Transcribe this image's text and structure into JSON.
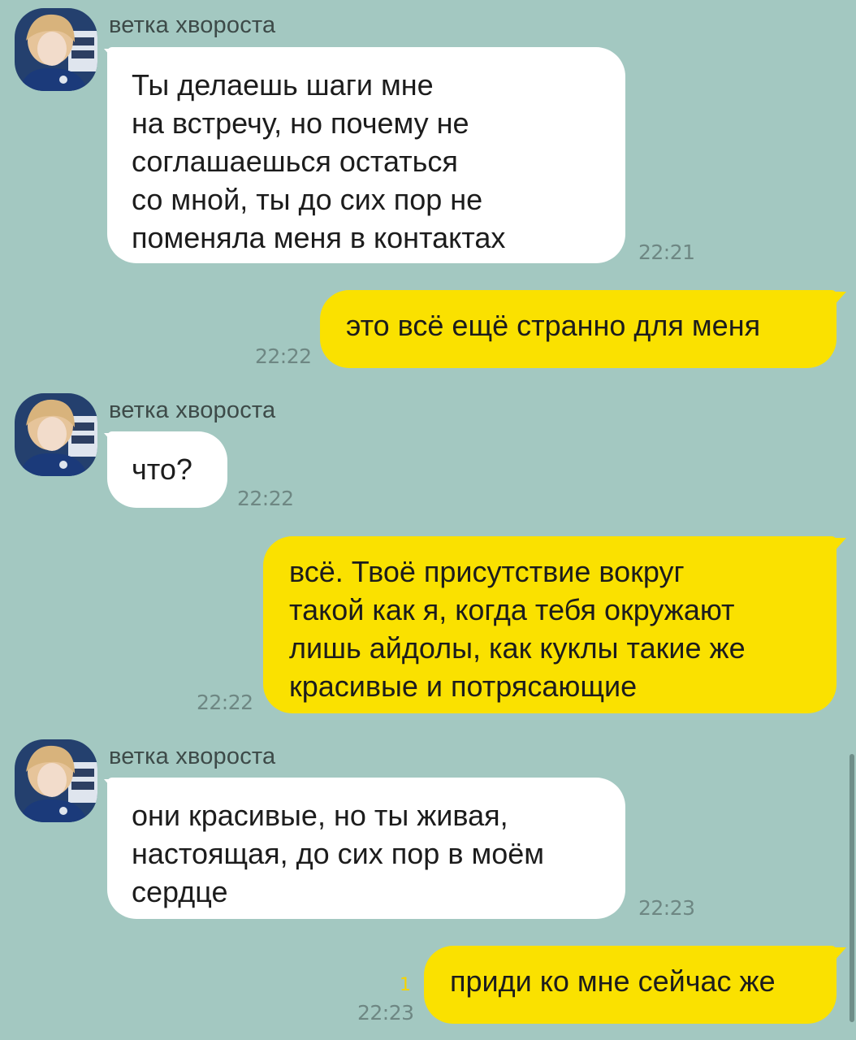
{
  "chat": {
    "sender_name": "ветка хвороста",
    "messages": [
      {
        "direction": "in",
        "text": "Ты делаешь шаги мне\nна встречу, но почему не\nсоглашаешься остаться\nсо мной, ты до сих пор не\nпоменяла меня в контактах",
        "time": "22:21"
      },
      {
        "direction": "out",
        "text": "это всё ещё странно для меня",
        "time": "22:22"
      },
      {
        "direction": "in",
        "text": "что?",
        "time": "22:22"
      },
      {
        "direction": "out",
        "text": "всё. Твоё присутствие вокруг\nтакой как я, когда тебя окружают\nлишь айдолы, как куклы такие же\nкрасивые и потрясающие",
        "time": "22:22"
      },
      {
        "direction": "in",
        "text": "они красивые, но ты живая,\nнастоящая, до сих пор в моём\nсердце",
        "time": "22:23"
      },
      {
        "direction": "out",
        "text": "приди ко мне сейчас же",
        "time": "22:23",
        "unread_count": "1"
      }
    ]
  },
  "colors": {
    "background": "#a3c8c1",
    "incoming_bubble": "#ffffff",
    "outgoing_bubble": "#fae100",
    "timestamp": "#6e8783",
    "unread_counter": "#f5d300"
  },
  "icons": {
    "avatar": "avatar-photo-icon"
  }
}
